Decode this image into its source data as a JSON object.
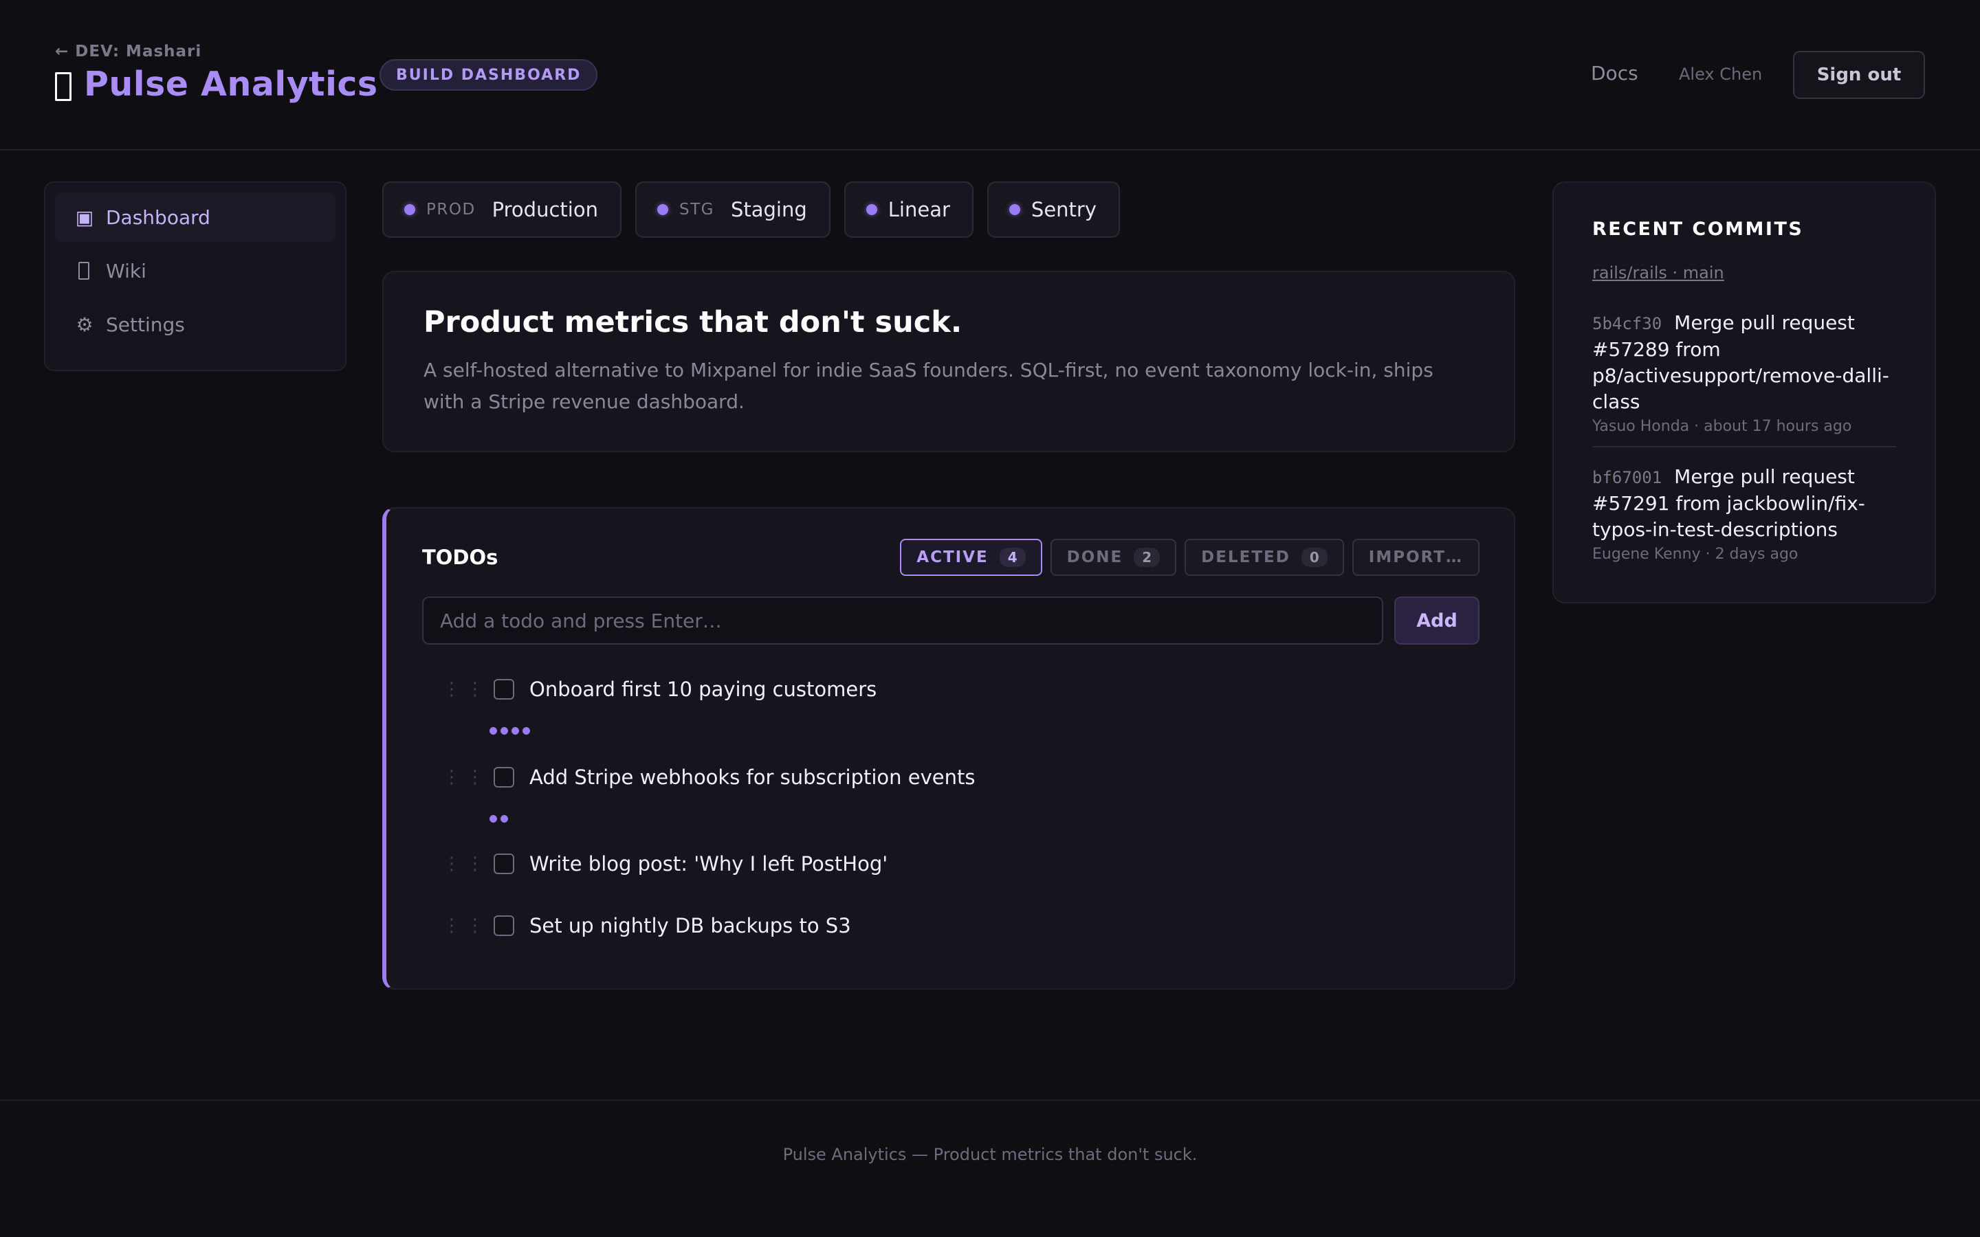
{
  "header": {
    "back_link": "← DEV: Mashari",
    "app_title": "Pulse Analytics",
    "build_badge": "BUILD DASHBOARD",
    "docs_link": "Docs",
    "user_name": "Alex Chen",
    "signout_label": "Sign out"
  },
  "sidebar": {
    "items": [
      {
        "label": "Dashboard",
        "icon": "dashboard-icon",
        "active": true
      },
      {
        "label": "Wiki",
        "icon": "wiki-icon",
        "active": false
      },
      {
        "label": "Settings",
        "icon": "gear-icon",
        "active": false
      }
    ]
  },
  "environments": [
    {
      "tag": "PROD",
      "label": "Production"
    },
    {
      "tag": "STG",
      "label": "Staging"
    },
    {
      "tag": "",
      "label": "Linear"
    },
    {
      "tag": "",
      "label": "Sentry"
    }
  ],
  "hero": {
    "title": "Product metrics that don't suck.",
    "description": "A self-hosted alternative to Mixpanel for indie SaaS founders. SQL-first, no event taxonomy lock-in, ships with a Stripe revenue dashboard."
  },
  "todos": {
    "title": "TODOs",
    "tabs": [
      {
        "label": "ACTIVE",
        "count": "4"
      },
      {
        "label": "DONE",
        "count": "2"
      },
      {
        "label": "DELETED",
        "count": "0"
      },
      {
        "label": "IMPORT…",
        "count": ""
      }
    ],
    "input_placeholder": "Add a todo and press Enter…",
    "add_label": "Add",
    "items": [
      {
        "text": "Onboard first 10 paying customers",
        "priority": 4
      },
      {
        "text": "Add Stripe webhooks for subscription events",
        "priority": 2
      },
      {
        "text": "Write blog post: 'Why I left PostHog'",
        "priority": 0
      },
      {
        "text": "Set up nightly DB backups to S3",
        "priority": 0
      }
    ]
  },
  "commits": {
    "title": "RECENT COMMITS",
    "repo": "rails/rails · main",
    "items": [
      {
        "sha": "5b4cf30",
        "message": "Merge pull request #57289 from p8/activesupport/remove-dalli-class",
        "meta": "Yasuo Honda · about 17 hours ago"
      },
      {
        "sha": "bf67001",
        "message": "Merge pull request #57291 from jackbowlin/fix-typos-in-test-descriptions",
        "meta": "Eugene Kenny · 2 days ago"
      }
    ]
  },
  "footer": {
    "text": "Pulse Analytics — Product metrics that don't suck."
  },
  "colors": {
    "accent": "#9b7cf2",
    "background": "#0f0f13",
    "card": "#16151d"
  }
}
